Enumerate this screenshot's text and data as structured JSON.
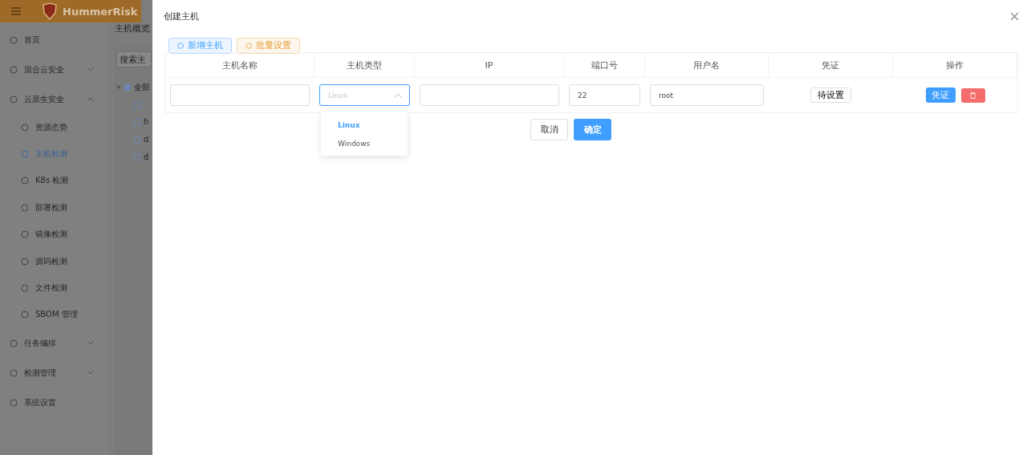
{
  "app": {
    "logo": "HummerRisk"
  },
  "sidebar": {
    "items": [
      {
        "label": "首页",
        "kind": "top",
        "selected": false
      },
      {
        "label": "混合云安全",
        "kind": "group",
        "expanded": false,
        "selected": false
      },
      {
        "label": "云原生安全",
        "kind": "group",
        "expanded": true,
        "selected": false
      },
      {
        "label": "资源态势",
        "kind": "sub",
        "selected": false
      },
      {
        "label": "主机检测",
        "kind": "sub",
        "selected": true
      },
      {
        "label": "K8s 检测",
        "kind": "sub",
        "selected": false
      },
      {
        "label": "部署检测",
        "kind": "sub",
        "selected": false
      },
      {
        "label": "镜像检测",
        "kind": "sub",
        "selected": false
      },
      {
        "label": "源码检测",
        "kind": "sub",
        "selected": false
      },
      {
        "label": "文件检测",
        "kind": "sub",
        "selected": false
      },
      {
        "label": "SBOM 管理",
        "kind": "sub",
        "selected": false
      },
      {
        "label": "任务编排",
        "kind": "group",
        "expanded": false,
        "selected": false
      },
      {
        "label": "检测管理",
        "kind": "group",
        "expanded": false,
        "selected": false
      },
      {
        "label": "系统设置",
        "kind": "top",
        "selected": false
      }
    ]
  },
  "content": {
    "breadcrumb": "主机概览",
    "search": {
      "placeholder": "搜索主"
    },
    "tree": {
      "label": "全部",
      "expanded": true,
      "children": [
        {
          "kind": "file"
        },
        {
          "kind": "file",
          "label": "h"
        },
        {
          "kind": "file",
          "label": "d"
        },
        {
          "kind": "file",
          "label": "d"
        }
      ]
    }
  },
  "drawer": {
    "title": "创建主机",
    "toolbar": [
      "新增主机",
      "批量设置"
    ],
    "table": {
      "columns": [
        "主机名称",
        "主机类型",
        "IP",
        "端口号",
        "用户名",
        "凭证",
        "操作"
      ],
      "rows": [
        {
          "name": {},
          "type": {
            "placeholder": "Linux",
            "focused": true
          },
          "ip": "",
          "port": "22",
          "user": "root",
          "credential": "待设置",
          "action": "凭证"
        }
      ]
    },
    "dropdown": {
      "options": [
        {
          "label": "Linux",
          "selected": true
        },
        {
          "label": "Windows",
          "selected": false
        }
      ]
    },
    "buttons": {
      "cancel": "取消",
      "confirm": "确定"
    }
  }
}
